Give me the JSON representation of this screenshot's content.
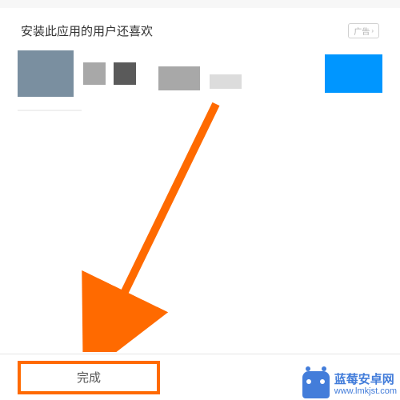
{
  "section": {
    "title": "安装此应用的用户还喜欢",
    "ad_label": "广告"
  },
  "bottom": {
    "done_label": "完成"
  },
  "watermark": {
    "title": "蓝莓安卓网",
    "url": "www.lmkjst.com"
  },
  "colors": {
    "highlight": "#ff6a00",
    "blue_tile": "#0096ff",
    "wm_blue": "#2f6fd6"
  }
}
